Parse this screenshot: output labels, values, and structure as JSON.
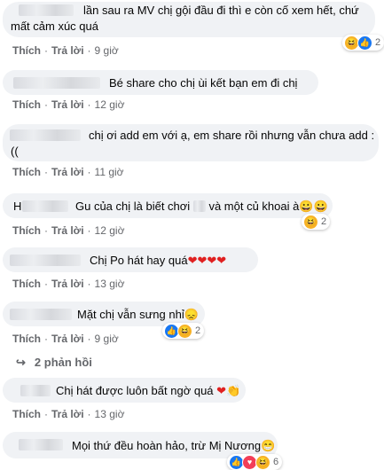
{
  "comments": [
    {
      "text_line1": "lần sau ra MV chị gội đầu đi thì e còn cố xem hết, chứ",
      "text_line2": "mất cảm xúc quá",
      "like": "Thích",
      "reply": "Trả lời",
      "time": "9 giờ",
      "reaction_count": "2"
    },
    {
      "text": "Bé share cho chị ùi kết bạn em đi chị",
      "like": "Thích",
      "reply": "Trả lời",
      "time": "12 giờ"
    },
    {
      "text_line1": "chị ơi add em với ạ, em share rồi nhưng vẫn chưa add :",
      "text_line2": "((",
      "like": "Thích",
      "reply": "Trả lời",
      "time": "11 giờ"
    },
    {
      "name_initial": "H",
      "text_before": "Gu của chị là biết chơi",
      "text_after": "và một củ khoai à",
      "emoji": "😀😀",
      "like": "Thích",
      "reply": "Trả lời",
      "time": "12 giờ",
      "reaction_count": "2"
    },
    {
      "text": "Chị Po hát hay quá",
      "emoji": "❤❤❤❤",
      "like": "Thích",
      "reply": "Trả lời",
      "time": "13 giờ"
    },
    {
      "text": "Mặt chị vẫn sưng nhỉ",
      "emoji": "😞",
      "like": "Thích",
      "reply": "Trả lời",
      "time": "9 giờ",
      "reaction_count": "2"
    },
    {
      "text": "Chị hát được luôn bất ngờ quá",
      "emoji": "❤👏",
      "like": "Thích",
      "reply": "Trả lời",
      "time": "13 giờ"
    },
    {
      "text": "Mọi thứ đều hoàn hảo, trừ Mị Nương",
      "emoji": "😁",
      "reaction_count": "6"
    }
  ],
  "replies_link": "2 phản hồi",
  "icons": {
    "reply_arrow": "reply-arrow-icon",
    "haha": "haha-reaction-icon",
    "like": "like-reaction-icon",
    "love": "love-reaction-icon"
  },
  "colors": {
    "bubble": "#f0f2f5",
    "meta": "#65676b",
    "like_blue": "#1877f2",
    "love_red": "#f33e58",
    "haha_yellow": "#f7b125"
  }
}
